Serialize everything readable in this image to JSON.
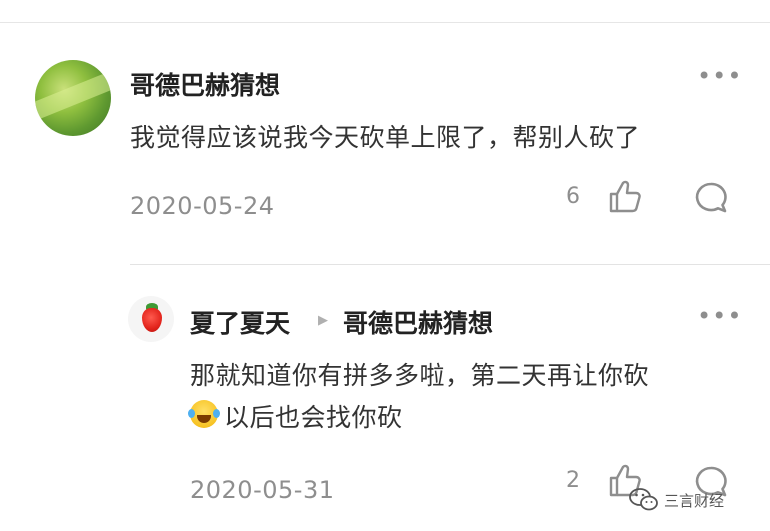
{
  "comment": {
    "author": "哥德巴赫猜想",
    "content": "我觉得应该说我今天砍单上限了，帮别人砍了",
    "date": "2020-05-24",
    "like_count": "6",
    "more_label": "•••"
  },
  "reply": {
    "author": "夏了夏天",
    "reply_to": "哥德巴赫猜想",
    "content_line1": "那就知道你有拼多多啦，第二天再让你砍",
    "content_line2": "以后也会找你砍",
    "date": "2020-05-31",
    "like_count": "2",
    "more_label": "•••"
  },
  "watermark": {
    "text": "三言财经"
  },
  "icons": [
    "thumbs-up-icon",
    "comment-bubble-icon",
    "more-dots-icon",
    "crying-laughing-emoji",
    "wechat-logo"
  ]
}
